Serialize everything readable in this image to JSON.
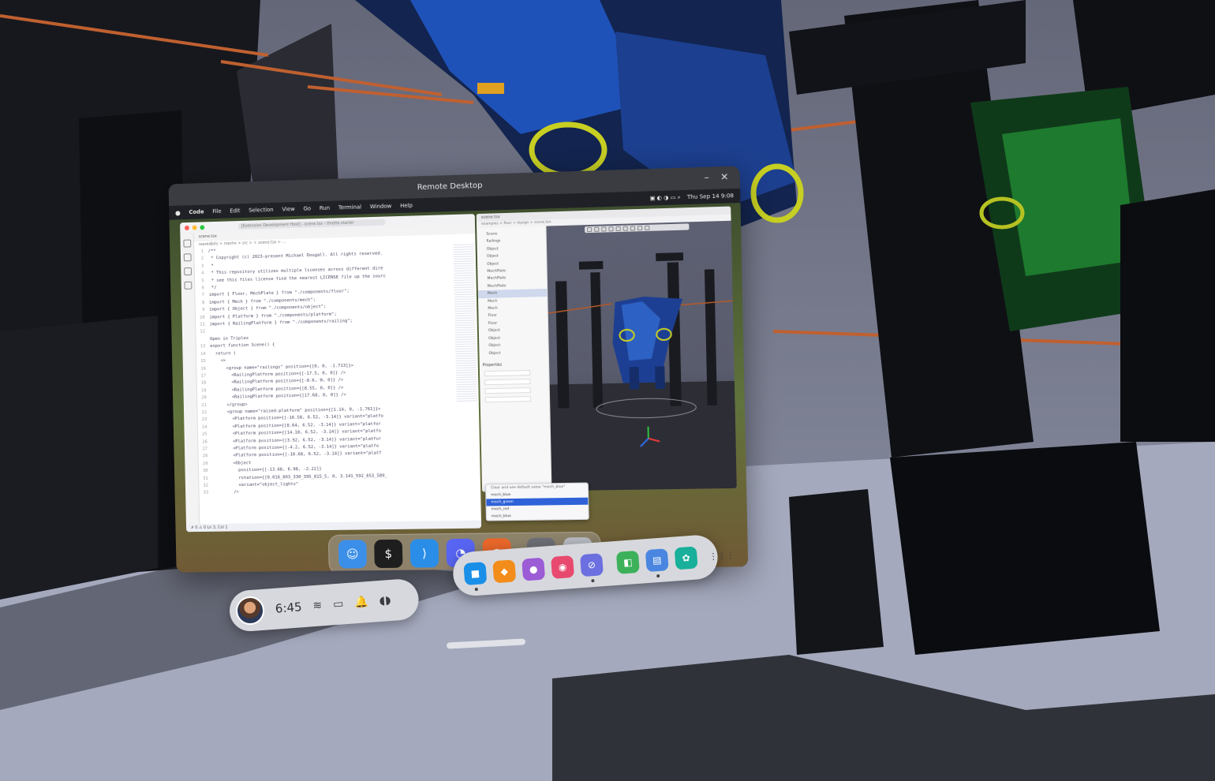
{
  "window": {
    "title": "Remote Desktop",
    "minimize_icon": "minimize-icon",
    "close_icon": "close-icon",
    "close_glyph": "✕",
    "minimize_glyph": "–"
  },
  "mac_menubar": {
    "items": [
      "Code",
      "File",
      "Edit",
      "Selection",
      "View",
      "Go",
      "Run",
      "Terminal",
      "Window",
      "Help"
    ],
    "right_text": "Thu Sep 14 9:08"
  },
  "vscode": {
    "search_text": "[Extension Development Host] - scene.tsx - threlte-starter",
    "tab": "scene.tsx",
    "breadcrumb": "rearedbits > mechs > src > ⚛ scene.tsx > ...",
    "status": "✗ 0 ⚠ 0  Ln 3, Col 1",
    "lines": [
      {
        "n": "1",
        "t": "/**"
      },
      {
        "n": "2",
        "t": " * Copyright (c) 2023-present Michael Dougall. All rights reserved."
      },
      {
        "n": "3",
        "t": " *"
      },
      {
        "n": "4",
        "t": " * This repository utilizes multiple licenses across different dire"
      },
      {
        "n": "5",
        "t": " * see this files license find the nearest LICENSE file up the sourc"
      },
      {
        "n": "6",
        "t": " */"
      },
      {
        "n": "7",
        "t": "import { Floor, MechPlate } from \"./components/floor\";"
      },
      {
        "n": "8",
        "t": "import { Mech } from \"./components/mech\";"
      },
      {
        "n": "9",
        "t": "import { Object } from \"./components/object\";"
      },
      {
        "n": "10",
        "t": "import { Platform } from \"./components/platform\";"
      },
      {
        "n": "11",
        "t": "import { RailingPlatform } from \"./components/railing\";"
      },
      {
        "n": "12",
        "t": ""
      },
      {
        "n": "",
        "t": "Open in Triplex"
      },
      {
        "n": "13",
        "t": "export function Scene() {"
      },
      {
        "n": "14",
        "t": "  return ("
      },
      {
        "n": "15",
        "t": "    <>"
      },
      {
        "n": "16",
        "t": "      <group name=\"railings\" position={[0, 0, -1.713]}>"
      },
      {
        "n": "17",
        "t": "        <RailingPlatform position={[-17.5, 0, 0]} />"
      },
      {
        "n": "18",
        "t": "        <RailingPlatform position={[-8.6, 0, 0]} />"
      },
      {
        "n": "19",
        "t": "        <RailingPlatform position={[8.55, 0, 0]} />"
      },
      {
        "n": "20",
        "t": "        <RailingPlatform position={[17.68, 0, 0]} />"
      },
      {
        "n": "21",
        "t": "      </group>"
      },
      {
        "n": "22",
        "t": "      <group name=\"raised-platform\" position={[1.14, 0, -1.761]}>"
      },
      {
        "n": "23",
        "t": "        <Platform position={[-16.58, 6.52, -3.14]} variant=\"platfo"
      },
      {
        "n": "24",
        "t": "        <Platform position={[8.64, 6.52, -3.14]} variant=\"platfor"
      },
      {
        "n": "25",
        "t": "        <Platform position={[14.18, 6.52, -3.14]} variant=\"platfo"
      },
      {
        "n": "26",
        "t": "        <Platform position={[3.92, 6.52, -3.14]} variant=\"platfor"
      },
      {
        "n": "27",
        "t": "        <Platform position={[-4.2, 6.52, -3.14]} variant=\"platfo"
      },
      {
        "n": "28",
        "t": "        <Platform position={[-10.68, 6.52, -3.14]} variant=\"platf"
      },
      {
        "n": "29",
        "t": "        <Object"
      },
      {
        "n": "30",
        "t": "          position={[-13.68, 6.98, -2.22]}"
      },
      {
        "n": "31",
        "t": "          rotation={[0.016_893_330_395_815_5, 0, 3.141_592_653_589_"
      },
      {
        "n": "32",
        "t": "          variant=\"object_lights\""
      },
      {
        "n": "33",
        "t": "        />"
      }
    ]
  },
  "scene_editor": {
    "tab": "scene.tsx",
    "breadcrumb": "examples > floor > design > scene.tsx",
    "tree": [
      "Scene",
      "Railings",
      "Object",
      "Object",
      "Object",
      "MechPlate",
      "MechPlate",
      "MechPlate",
      "Mech",
      "Mech",
      "Mech",
      "Floor",
      "Floor",
      "Object",
      "Object",
      "Object",
      "Object"
    ],
    "selected_index": 8,
    "props_header": "Properties",
    "dropdown": {
      "title": "Clear and use default value \"mech_blue\"",
      "items": [
        "mech_blue",
        "mech_green",
        "mech_red",
        "mech_blue"
      ],
      "selected_index": 1
    }
  },
  "dock": {
    "apps": [
      {
        "name": "finder",
        "icon": "finder-icon",
        "glyph": "☺",
        "color": "#3b8fe8"
      },
      {
        "name": "terminal",
        "icon": "terminal-icon",
        "glyph": "$",
        "color": "#1e1e1e"
      },
      {
        "name": "vscode",
        "icon": "vscode-icon",
        "glyph": "⟩",
        "color": "#2a8ee8"
      },
      {
        "name": "discord",
        "icon": "discord-icon",
        "glyph": "◔",
        "color": "#5865f2"
      },
      {
        "name": "firefox",
        "icon": "firefox-icon",
        "glyph": "◉",
        "color": "#e9672a"
      }
    ],
    "extras": [
      {
        "name": "screenshot",
        "icon": "screenshot-icon",
        "glyph": "▣",
        "color": "#6d6f76"
      },
      {
        "name": "trash",
        "icon": "trash-icon",
        "glyph": "▥",
        "color": "#b9bcc4"
      }
    ]
  },
  "quest": {
    "time": "6:45",
    "status_icons": [
      "wifi-icon",
      "battery-icon",
      "notifications-icon",
      "controller-icon"
    ],
    "status_glyphs": [
      "≋",
      "▭",
      "🔔",
      "◖◗"
    ],
    "apps": [
      {
        "name": "store",
        "icon": "store-icon",
        "glyph": "■",
        "color": "#1a8fe8",
        "active": true
      },
      {
        "name": "explore",
        "icon": "explore-icon",
        "glyph": "◆",
        "color": "#f28c1a",
        "active": false
      },
      {
        "name": "people",
        "icon": "people-icon",
        "glyph": "●",
        "color": "#9b5cd6",
        "active": false
      },
      {
        "name": "camera",
        "icon": "camera-icon",
        "glyph": "◉",
        "color": "#e84a6f",
        "active": false
      },
      {
        "name": "browser",
        "icon": "browser-icon",
        "glyph": "⊘",
        "color": "#6b6fe0",
        "active": true
      },
      {
        "name": "files",
        "icon": "files-icon",
        "glyph": "◧",
        "color": "#3cb15a",
        "active": false
      },
      {
        "name": "remote-desktop",
        "icon": "remote-desktop-icon",
        "glyph": "▤",
        "color": "#4a86e0",
        "active": true
      },
      {
        "name": "settings",
        "icon": "settings-icon",
        "glyph": "✿",
        "color": "#18b09a",
        "active": false
      }
    ],
    "library_icon": "app-library-icon",
    "library_glyph": "⋮⋮⋮"
  }
}
